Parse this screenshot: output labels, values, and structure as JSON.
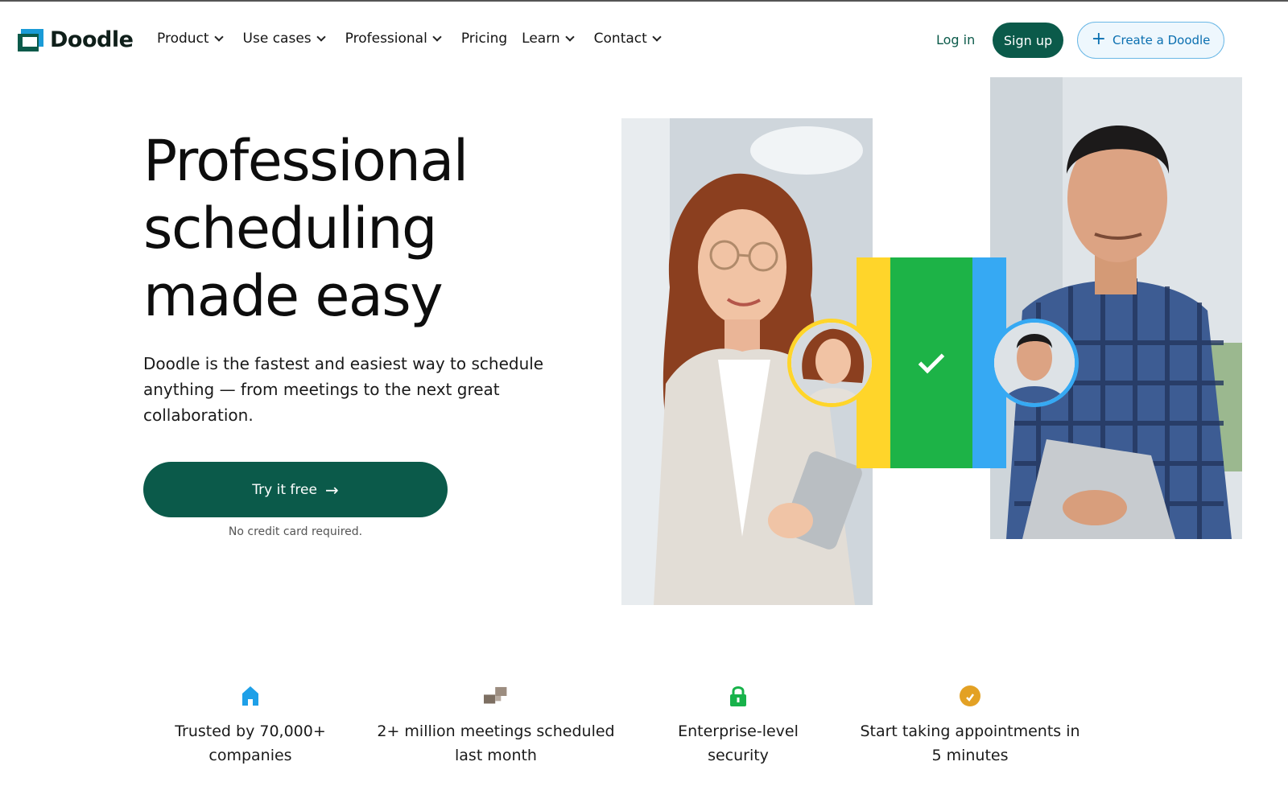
{
  "brand": {
    "name": "Doodle"
  },
  "nav": {
    "items": [
      {
        "label": "Product",
        "has_dropdown": true
      },
      {
        "label": "Use cases",
        "has_dropdown": true
      },
      {
        "label": "Professional",
        "has_dropdown": true
      },
      {
        "label": "Pricing",
        "has_dropdown": false
      },
      {
        "label": "Learn",
        "has_dropdown": true
      },
      {
        "label": "Contact",
        "has_dropdown": true
      }
    ],
    "login_label": "Log in",
    "signup_label": "Sign up",
    "create_label": "Create a Doodle"
  },
  "hero": {
    "title_lines": [
      "Professional",
      "scheduling",
      "made easy"
    ],
    "subtitle": "Doodle is the fastest and easiest way to schedule anything — from meetings to the next great collaboration.",
    "cta_label": "Try it free",
    "cta_note": "No credit card required."
  },
  "features": [
    {
      "icon": "house-icon",
      "text": "Trusted by 70,000+ companies"
    },
    {
      "icon": "blocks-icon",
      "text": "2+ million meetings scheduled last month"
    },
    {
      "icon": "lock-icon",
      "text": "Enterprise-level security"
    },
    {
      "icon": "clock-icon",
      "text": "Start taking appointments in 5 minutes"
    }
  ],
  "colors": {
    "brand_green": "#0b5a4a",
    "brand_blue": "#1a9bd7",
    "yellow": "#ffd52a",
    "green": "#1db347",
    "blue": "#36a9f3"
  }
}
